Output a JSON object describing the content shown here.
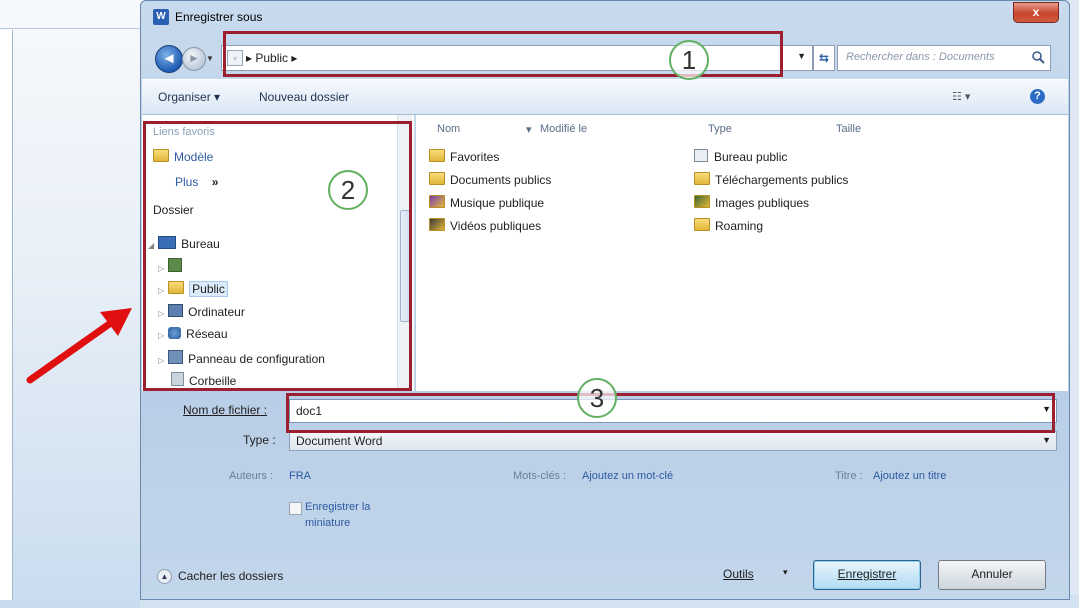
{
  "dialog": {
    "title": "Enregistrer sous",
    "app_icon": "W",
    "close_label": "x"
  },
  "address": {
    "path": "▸  Public  ▸",
    "search_placeholder": "Rechercher dans : Documents"
  },
  "toolbar": {
    "organize_label": "Organiser ▾",
    "new_folder_label": "Nouveau dossier",
    "view_label": "☷  ▾",
    "help_label": "?"
  },
  "nav": {
    "favorites_header": "Liens favoris",
    "items": {
      "modele": "Modèle",
      "plus": "Plus",
      "plus_more": "»",
      "dossier": "Dossier",
      "bureau": "Bureau",
      "public": "Public",
      "ordinateur": "Ordinateur",
      "reseau": "Réseau",
      "panneau": "Panneau de configuration",
      "corbeille": "Corbeille"
    }
  },
  "filelist": {
    "columns": {
      "name": "Nom",
      "modified": "Modifié le",
      "type": "Type",
      "size": "Taille"
    },
    "files_left": [
      "Favorites",
      "Documents publics",
      "Musique publique",
      "Vidéos publiques"
    ],
    "files_right": [
      "Bureau public",
      "Téléchargements publics",
      "Images publiques",
      "Roaming"
    ]
  },
  "form": {
    "filename_label": "Nom de fichier :",
    "filename_value": "doc1",
    "type_label": "Type :",
    "type_value": "Document Word",
    "authors_label": "Auteurs :",
    "authors_value": "FRA",
    "keywords_label": "Mots-clés :",
    "keywords_value": "Ajoutez un mot-clé",
    "title_label": "Titre :",
    "title_value": "Ajoutez un titre",
    "thumbnail_line1": "Enregistrer la",
    "thumbnail_line2": "miniature"
  },
  "footer": {
    "hide_folders_label": "Cacher les dossiers",
    "tools_label": "Outils",
    "tools_arrow": "▾",
    "save_label": "Enregistrer",
    "cancel_label": "Annuler"
  },
  "annotations": {
    "one": "1",
    "two": "2",
    "three": "3"
  },
  "colors": {
    "annotation_red": "#9b1f2f",
    "arrow_red": "#e01010",
    "circle_green": "#60b060"
  }
}
